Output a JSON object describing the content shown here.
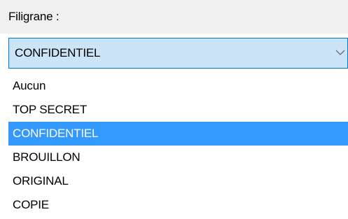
{
  "watermark": {
    "label": "Filigrane :",
    "selected_value": "CONFIDENTIEL",
    "chevron_icon": "chevron-down-icon",
    "options": [
      {
        "label": "Aucun",
        "selected": false
      },
      {
        "label": "TOP SECRET",
        "selected": false
      },
      {
        "label": "CONFIDENTIEL",
        "selected": true
      },
      {
        "label": "BROUILLON",
        "selected": false
      },
      {
        "label": "ORIGINAL",
        "selected": false
      },
      {
        "label": "COPIE",
        "selected": false
      }
    ]
  },
  "colors": {
    "header_background": "#f0f0f0",
    "combo_background": "#cce4f7",
    "combo_border": "#0078d7",
    "highlight": "#3399ff",
    "highlight_text": "#ffffff"
  }
}
